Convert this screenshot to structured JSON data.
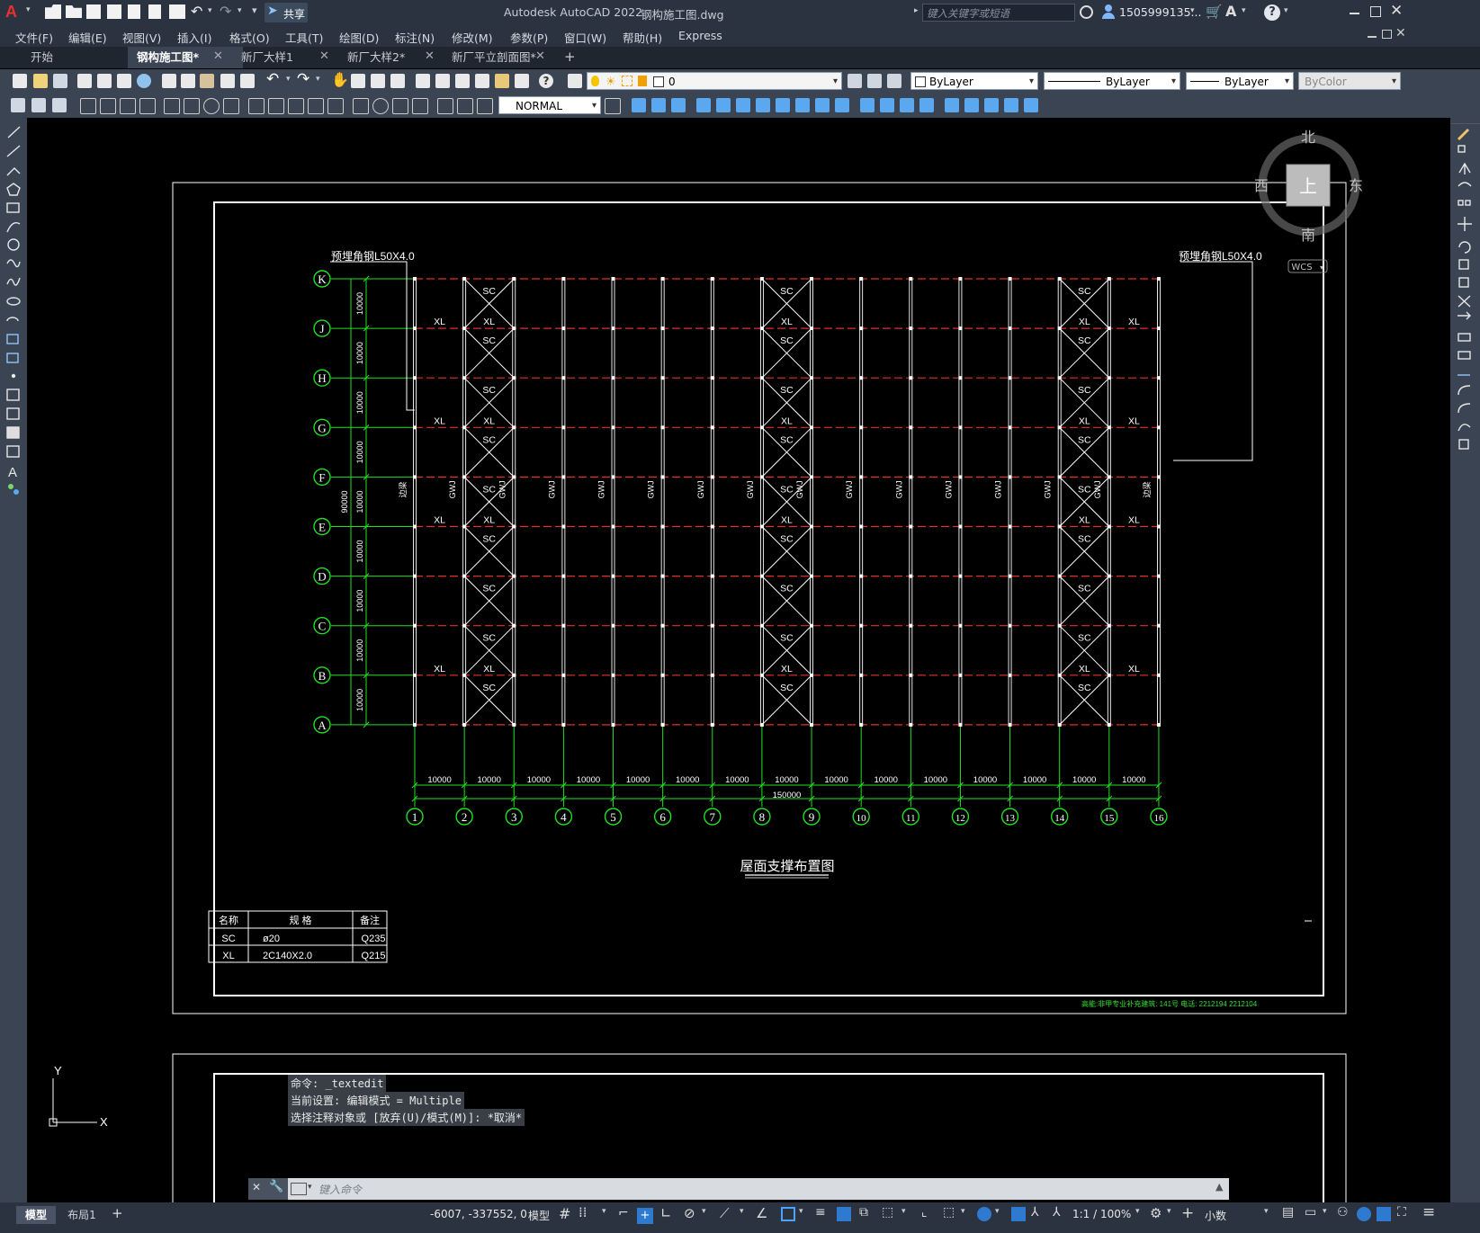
{
  "title_bar": {
    "app_title": "Autodesk AutoCAD 2022",
    "file_name": "钢构施工图.dwg",
    "share_label": "共享",
    "search_placeholder": "键入关键字或短语",
    "user_name": "1505999135...",
    "logo_letter": "A"
  },
  "menu": {
    "items": [
      "文件(F)",
      "编辑(E)",
      "视图(V)",
      "插入(I)",
      "格式(O)",
      "工具(T)",
      "绘图(D)",
      "标注(N)",
      "修改(M)",
      "参数(P)",
      "窗口(W)",
      "帮助(H)",
      "Express"
    ]
  },
  "tabs": [
    {
      "label": "开始",
      "active": false,
      "closable": false
    },
    {
      "label": "钢构施工图*",
      "active": true,
      "closable": true
    },
    {
      "label": "新厂大样1",
      "active": false,
      "closable": true
    },
    {
      "label": "新厂大样2*",
      "active": false,
      "closable": true
    },
    {
      "label": "新厂平立剖面图*",
      "active": false,
      "closable": true
    }
  ],
  "toolbar": {
    "layer_value": "0",
    "color_value": "ByLayer",
    "linetype_value": "ByLayer",
    "lineweight_value": "ByLayer",
    "plotstyle_value": "ByColor",
    "dimstyle_value": "NORMAL"
  },
  "viewcube": {
    "north": "北",
    "south": "南",
    "east": "东",
    "west": "西",
    "face": "上",
    "wcs_label": "WCS"
  },
  "drawing": {
    "title": "屋面支撑布置图",
    "embedded_steel_label": "预埋角钢L50X4.0",
    "row_axes": [
      "K",
      "J",
      "H",
      "G",
      "F",
      "E",
      "D",
      "C",
      "B",
      "A"
    ],
    "col_axes": [
      "1",
      "2",
      "3",
      "4",
      "5",
      "6",
      "7",
      "8",
      "9",
      "10",
      "11",
      "12",
      "13",
      "14",
      "15",
      "16"
    ],
    "row_spacing_label": "10000",
    "total_height_label": "90000",
    "col_spacing_label": "10000",
    "total_width_label": "150000",
    "sc_label": "SC",
    "xl_label": "XL",
    "gwj_label": "GWJ",
    "edge_col_label": "边梁",
    "footer_note": "高能:非甲专业补充建筑: 141号     电话: 2212194     2212104",
    "legend": {
      "headers": [
        "名称",
        "规  格",
        "备注"
      ],
      "rows": [
        [
          "SC",
          "ø20",
          "Q235"
        ],
        [
          "XL",
          "2C140X2.0",
          "Q215"
        ]
      ]
    }
  },
  "command": {
    "history": [
      "命令: _textedit",
      "当前设置: 编辑模式 = Multiple",
      "选择注释对象或 [放弃(U)/模式(M)]: *取消*"
    ],
    "placeholder": "键入命令"
  },
  "ucs": {
    "x_label": "X",
    "y_label": "Y"
  },
  "status": {
    "model_tab": "模型",
    "layout_tab": "布局1",
    "coords": "-6007, -337552, 0",
    "model_label": "模型",
    "scale": "1:1 / 100%",
    "units": "小数"
  }
}
